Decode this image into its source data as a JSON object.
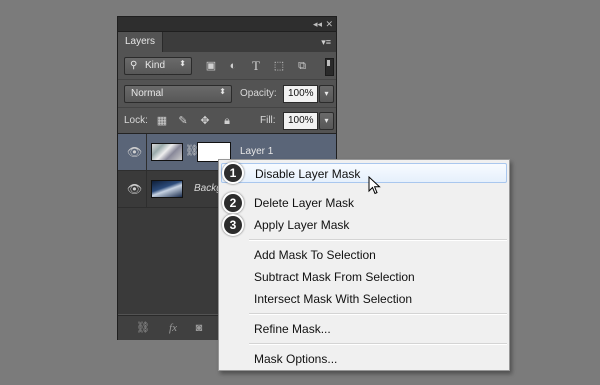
{
  "panel": {
    "tab_label": "Layers",
    "collapse_icon": "double-chevron-icon",
    "close_icon": "close-icon",
    "panel_menu_icon": "panel-menu-icon"
  },
  "filter": {
    "kind_label": "Kind"
  },
  "blend": {
    "mode": "Normal",
    "opacity_label": "Opacity:",
    "opacity_value": "100%",
    "lock_label": "Lock:",
    "fill_label": "Fill:",
    "fill_value": "100%"
  },
  "layers": [
    {
      "name": "Layer 1",
      "selected": true,
      "has_mask": true
    },
    {
      "name": "Backg",
      "selected": false,
      "has_mask": false
    }
  ],
  "bottom": {
    "fx_label": "fx"
  },
  "context_menu": {
    "items": [
      {
        "label": "Disable Layer Mask",
        "badge": "1",
        "hover": true
      },
      {
        "label": "Delete Layer Mask",
        "badge": "2"
      },
      {
        "label": "Apply Layer Mask",
        "badge": "3"
      },
      {
        "label": "Add Mask To Selection"
      },
      {
        "label": "Subtract Mask From Selection"
      },
      {
        "label": "Intersect Mask With Selection"
      },
      {
        "label": "Refine Mask..."
      },
      {
        "label": "Mask Options..."
      }
    ]
  },
  "colors": {
    "background": "#7b7b7b",
    "panel": "#535353",
    "selected_layer": "#5a6578",
    "menu_hover_border": "#a9c7ee"
  }
}
